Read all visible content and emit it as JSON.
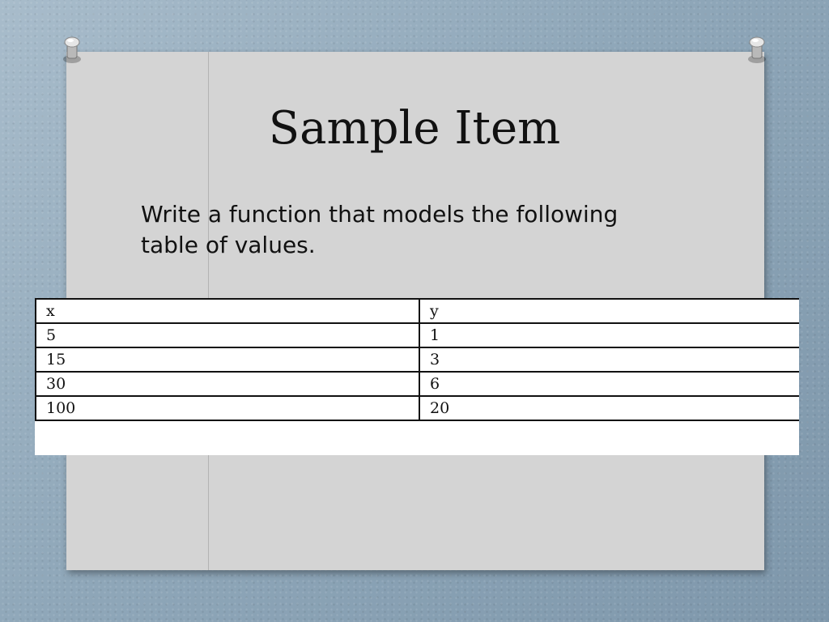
{
  "slide": {
    "title": "Sample Item",
    "prompt": "Write a function that models the following table of values."
  },
  "table": {
    "headers": [
      "x",
      "y"
    ],
    "rows": [
      [
        "5",
        "1"
      ],
      [
        "15",
        "3"
      ],
      [
        "30",
        "6"
      ],
      [
        "100",
        "20"
      ]
    ]
  }
}
